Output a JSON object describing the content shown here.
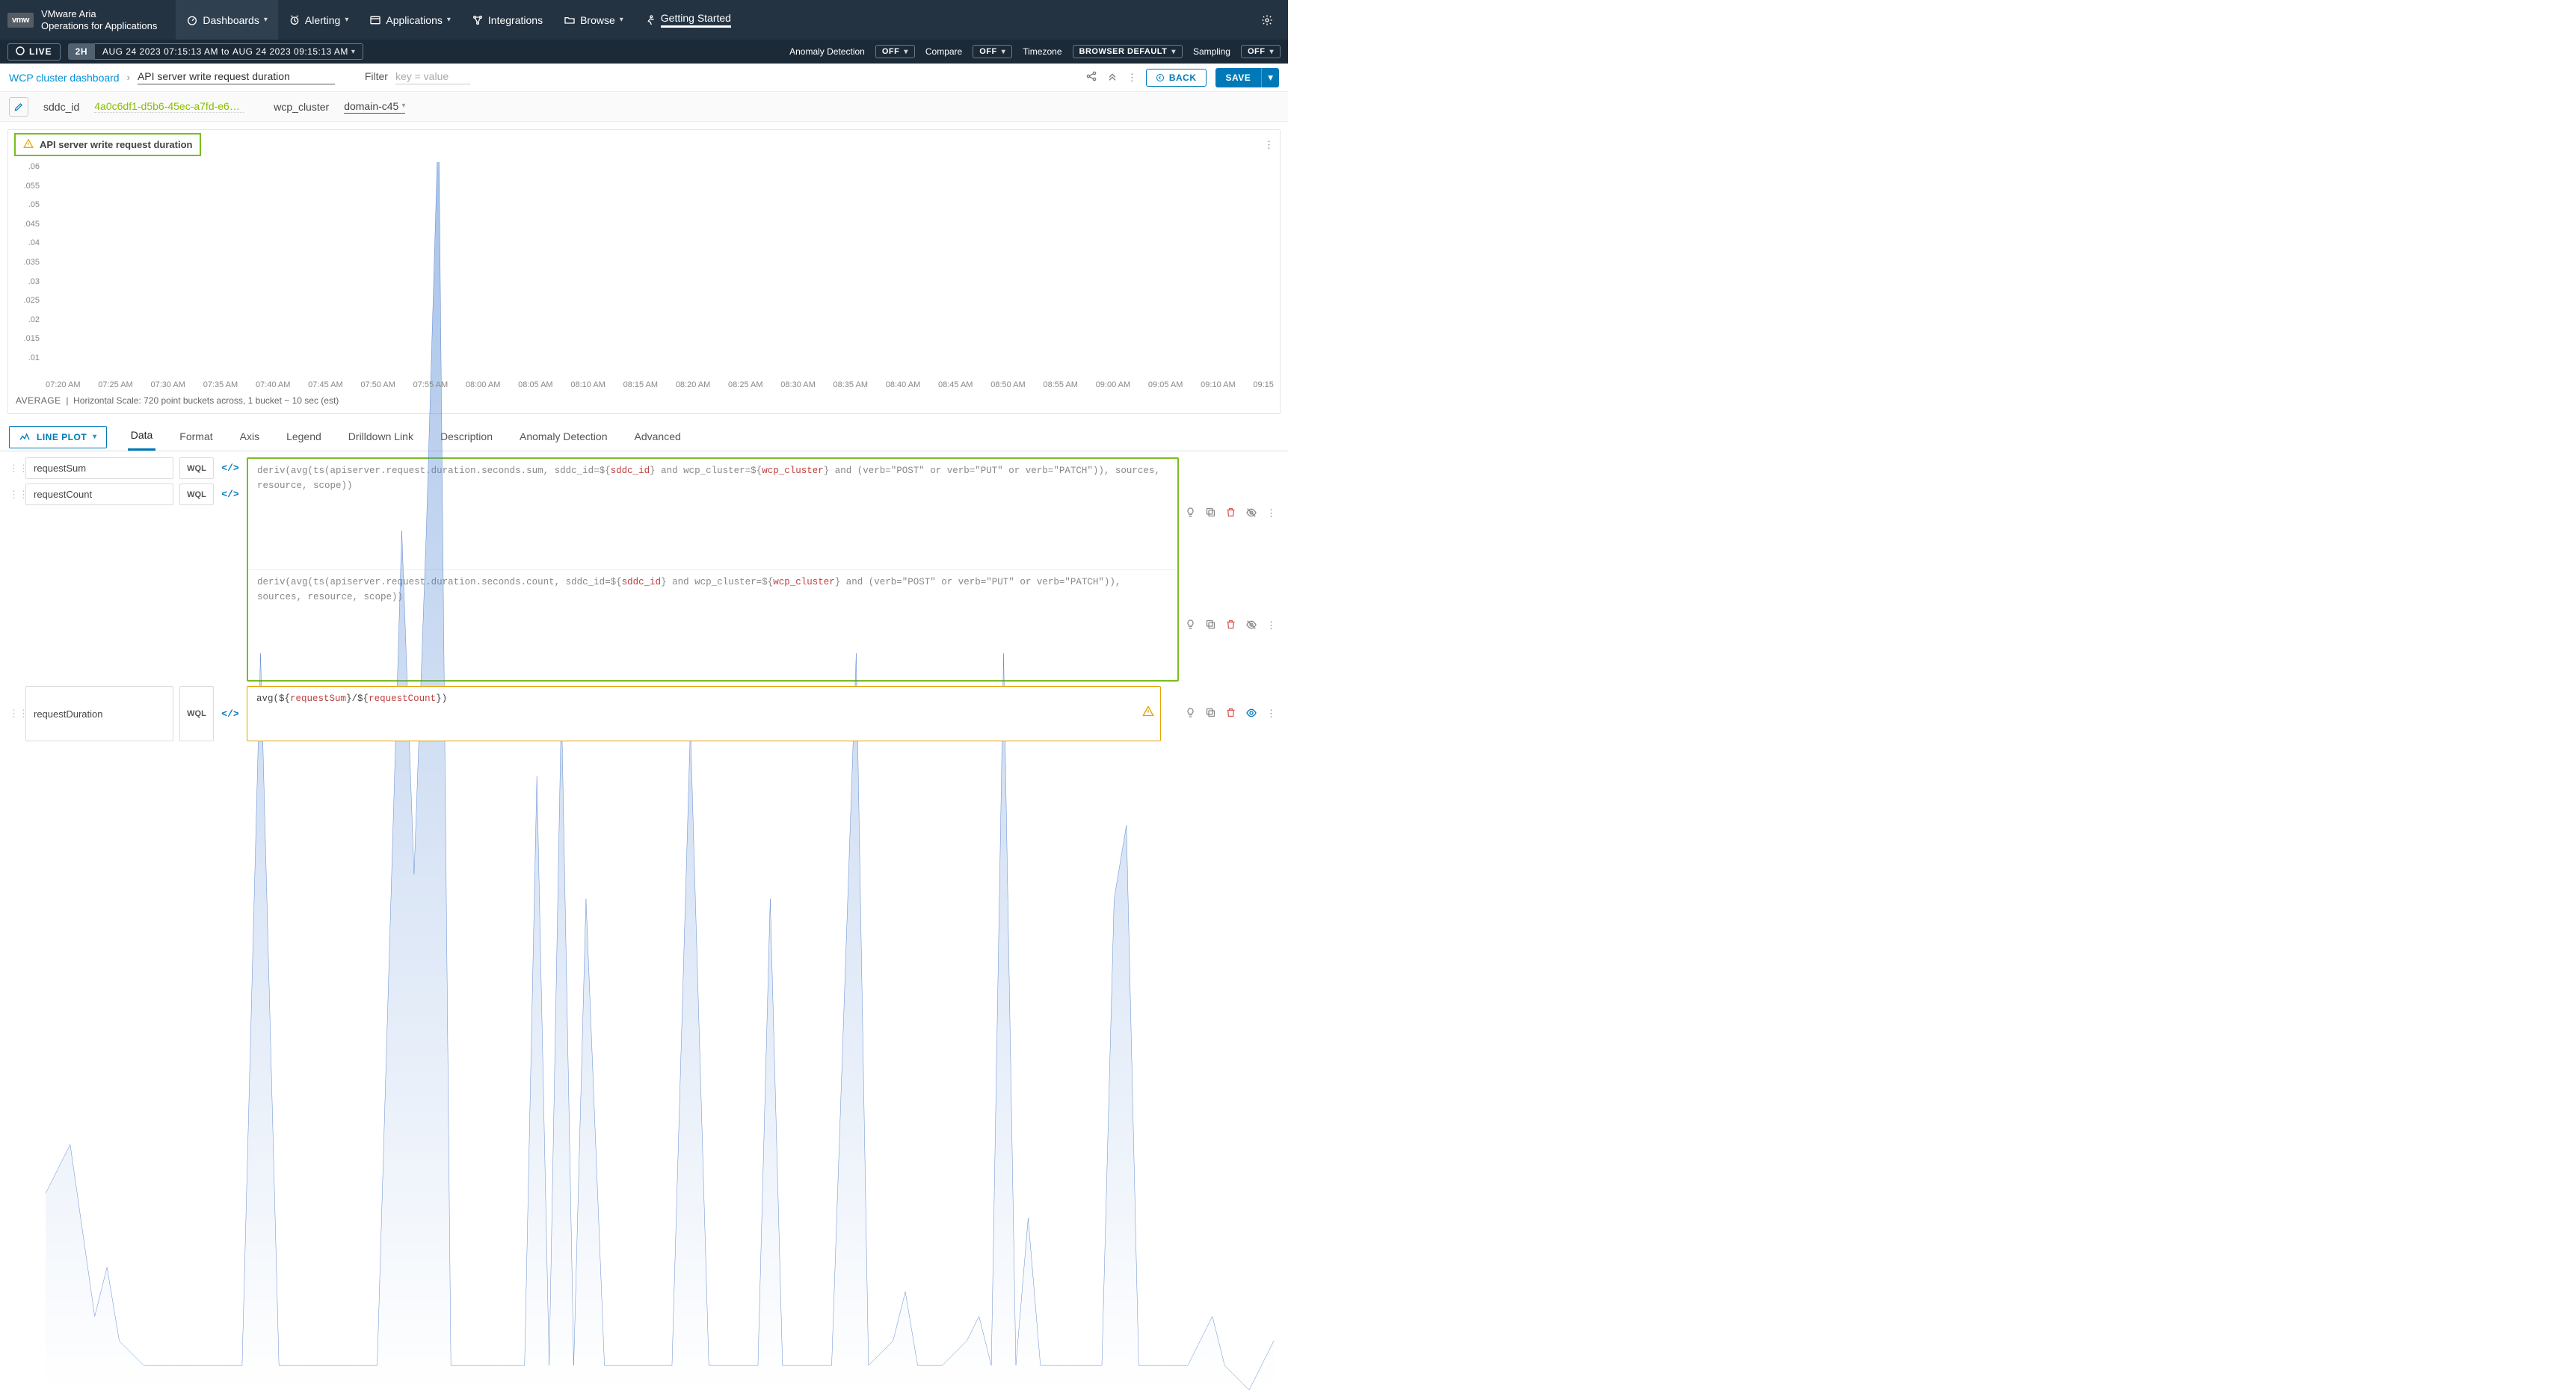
{
  "brand": {
    "logo": "vmw",
    "line1": "VMware Aria",
    "line2": "Operations for Applications"
  },
  "nav": {
    "dashboards": "Dashboards",
    "alerting": "Alerting",
    "applications": "Applications",
    "integrations": "Integrations",
    "browse": "Browse",
    "getting_started": "Getting Started"
  },
  "timebar": {
    "live": "LIVE",
    "range_short": "2H",
    "range_from": "AUG 24 2023 07:15:13 AM",
    "range_to_label": "to",
    "range_to": "AUG 24 2023 09:15:13 AM",
    "anomaly_label": "Anomaly Detection",
    "anomaly_value": "OFF",
    "compare_label": "Compare",
    "compare_value": "OFF",
    "timezone_label": "Timezone",
    "timezone_value": "BROWSER DEFAULT",
    "sampling_label": "Sampling",
    "sampling_value": "OFF"
  },
  "crumb": {
    "parent": "WCP cluster dashboard",
    "current": "API server write request duration",
    "filter_label": "Filter",
    "filter_placeholder": "key = value",
    "back": "BACK",
    "save": "SAVE"
  },
  "vars": {
    "sddc_label": "sddc_id",
    "sddc_value": "4a0c6df1-d5b6-45ec-a7fd-e6411...",
    "wcp_label": "wcp_cluster",
    "wcp_value": "domain-c45"
  },
  "chart": {
    "title": "API server write request duration",
    "footer_avg": "AVERAGE",
    "footer_sep": "|",
    "footer_text": "Horizontal Scale: 720 point buckets across, 1 bucket ~ 10 sec (est)"
  },
  "chart_data": {
    "type": "area",
    "title": "API server write request duration",
    "ylabel": "",
    "ylim": [
      0.01,
      0.06
    ],
    "y_ticks": [
      ".06",
      ".055",
      ".05",
      ".045",
      ".04",
      ".035",
      ".03",
      ".025",
      ".02",
      ".015",
      ".01"
    ],
    "x_ticks": [
      "07:20 AM",
      "07:25 AM",
      "07:30 AM",
      "07:35 AM",
      "07:40 AM",
      "07:45 AM",
      "07:50 AM",
      "07:55 AM",
      "08:00 AM",
      "08:05 AM",
      "08:10 AM",
      "08:15 AM",
      "08:20 AM",
      "08:25 AM",
      "08:30 AM",
      "08:35 AM",
      "08:40 AM",
      "08:45 AM",
      "08:50 AM",
      "08:55 AM",
      "09:00 AM",
      "09:05 AM",
      "09:10 AM",
      "09:15"
    ],
    "series": [
      {
        "name": "requestDuration",
        "points": [
          [
            0,
            0.018
          ],
          [
            2,
            0.02
          ],
          [
            4,
            0.013
          ],
          [
            5,
            0.015
          ],
          [
            6,
            0.012
          ],
          [
            8,
            0.011
          ],
          [
            10,
            0.011
          ],
          [
            12,
            0.011
          ],
          [
            14,
            0.011
          ],
          [
            16,
            0.011
          ],
          [
            17.5,
            0.04
          ],
          [
            19,
            0.011
          ],
          [
            21,
            0.011
          ],
          [
            23,
            0.011
          ],
          [
            25,
            0.011
          ],
          [
            27,
            0.011
          ],
          [
            29,
            0.045
          ],
          [
            30,
            0.031
          ],
          [
            31,
            0.045
          ],
          [
            32,
            0.062
          ],
          [
            33,
            0.011
          ],
          [
            35,
            0.011
          ],
          [
            37,
            0.011
          ],
          [
            39,
            0.011
          ],
          [
            40,
            0.035
          ],
          [
            41,
            0.011
          ],
          [
            42,
            0.038
          ],
          [
            43,
            0.011
          ],
          [
            44,
            0.03
          ],
          [
            45.5,
            0.011
          ],
          [
            47,
            0.011
          ],
          [
            49,
            0.011
          ],
          [
            51,
            0.011
          ],
          [
            52.5,
            0.037
          ],
          [
            54,
            0.011
          ],
          [
            56,
            0.011
          ],
          [
            58,
            0.011
          ],
          [
            59,
            0.03
          ],
          [
            60,
            0.011
          ],
          [
            62,
            0.011
          ],
          [
            64,
            0.011
          ],
          [
            66,
            0.04
          ],
          [
            67,
            0.011
          ],
          [
            69,
            0.012
          ],
          [
            70,
            0.014
          ],
          [
            71,
            0.011
          ],
          [
            73,
            0.011
          ],
          [
            75,
            0.012
          ],
          [
            76,
            0.013
          ],
          [
            77,
            0.011
          ],
          [
            78,
            0.04
          ],
          [
            79,
            0.011
          ],
          [
            80,
            0.017
          ],
          [
            81,
            0.011
          ],
          [
            83,
            0.011
          ],
          [
            85,
            0.011
          ],
          [
            86,
            0.011
          ],
          [
            87,
            0.03
          ],
          [
            88,
            0.033
          ],
          [
            89,
            0.011
          ],
          [
            91,
            0.011
          ],
          [
            93,
            0.011
          ],
          [
            95,
            0.013
          ],
          [
            96,
            0.011
          ],
          [
            98,
            0.01
          ],
          [
            100,
            0.012
          ]
        ]
      }
    ]
  },
  "editor": {
    "plot_type": "LINE PLOT",
    "tabs": {
      "data": "Data",
      "format": "Format",
      "axis": "Axis",
      "legend": "Legend",
      "drilldown": "Drilldown Link",
      "description": "Description",
      "anomaly": "Anomaly Detection",
      "advanced": "Advanced"
    }
  },
  "queries": [
    {
      "name": "requestSum",
      "wql": "WQL",
      "expr_parts": [
        {
          "t": "fn",
          "v": "deriv("
        },
        {
          "t": "fn",
          "v": "avg("
        },
        {
          "t": "fn",
          "v": "ts("
        },
        {
          "t": "txt",
          "v": "apiserver.request.duration.seconds.sum, sddc_id=${"
        },
        {
          "t": "var",
          "v": "sddc_id"
        },
        {
          "t": "txt",
          "v": "} "
        },
        {
          "t": "kw",
          "v": "and"
        },
        {
          "t": "txt",
          "v": " wcp_cluster=${"
        },
        {
          "t": "var",
          "v": "wcp_cluster"
        },
        {
          "t": "txt",
          "v": "} "
        },
        {
          "t": "kw",
          "v": "and"
        },
        {
          "t": "txt",
          "v": " (verb="
        },
        {
          "t": "str",
          "v": "\"POST\""
        },
        {
          "t": "txt",
          "v": " or verb="
        },
        {
          "t": "str",
          "v": "\"PUT\""
        },
        {
          "t": "txt",
          "v": " or verb="
        },
        {
          "t": "str",
          "v": "\"PATCH\""
        },
        {
          "t": "txt",
          "v": ")), sources, resource, scope))"
        }
      ],
      "hidden": true
    },
    {
      "name": "requestCount",
      "wql": "WQL",
      "expr_parts": [
        {
          "t": "fn",
          "v": "deriv("
        },
        {
          "t": "fn",
          "v": "avg("
        },
        {
          "t": "fn",
          "v": "ts("
        },
        {
          "t": "txt",
          "v": "apiserver.request.duration.seconds.count, sddc_id=${"
        },
        {
          "t": "var",
          "v": "sddc_id"
        },
        {
          "t": "txt",
          "v": "} "
        },
        {
          "t": "kw",
          "v": "and"
        },
        {
          "t": "txt",
          "v": " wcp_cluster=${"
        },
        {
          "t": "var",
          "v": "wcp_cluster"
        },
        {
          "t": "txt",
          "v": "} "
        },
        {
          "t": "kw",
          "v": "and"
        },
        {
          "t": "txt",
          "v": " (verb="
        },
        {
          "t": "str",
          "v": "\"POST\""
        },
        {
          "t": "txt",
          "v": " or verb="
        },
        {
          "t": "str",
          "v": "\"PUT\""
        },
        {
          "t": "txt",
          "v": " or verb="
        },
        {
          "t": "str",
          "v": "\"PATCH\""
        },
        {
          "t": "txt",
          "v": ")), sources, resource, scope))"
        }
      ],
      "hidden": true
    },
    {
      "name": "requestDuration",
      "wql": "WQL",
      "expr_parts": [
        {
          "t": "fn",
          "v": "avg("
        },
        {
          "t": "txt",
          "v": "${"
        },
        {
          "t": "var",
          "v": "requestSum"
        },
        {
          "t": "txt",
          "v": "}/${"
        },
        {
          "t": "var",
          "v": "requestCount"
        },
        {
          "t": "txt",
          "v": "})"
        }
      ],
      "hidden": false,
      "warn": true
    }
  ]
}
